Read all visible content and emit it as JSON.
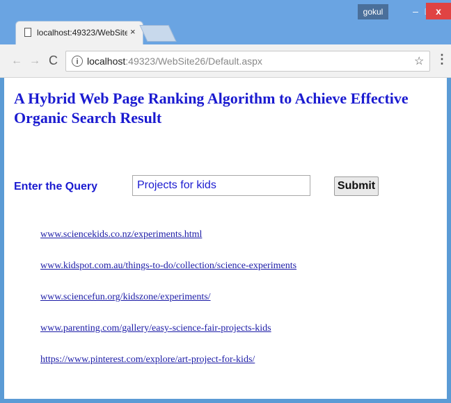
{
  "window": {
    "user_badge": "gokul",
    "minimize_glyph": "–",
    "maximize_glyph": "□",
    "close_glyph": "x"
  },
  "tab": {
    "title": "localhost:49323/WebSite",
    "close_glyph": "×",
    "icon": "page-icon"
  },
  "toolbar": {
    "back_glyph": "←",
    "forward_glyph": "→",
    "reload_glyph": "C",
    "info_glyph": "i",
    "url_host": "localhost",
    "url_rest": ":49323/WebSite26/Default.aspx",
    "star_glyph": "☆",
    "menu_glyph": "⋮"
  },
  "page": {
    "heading": "A Hybrid Web Page Ranking Algorithm to Achieve Effective Organic Search Result",
    "query_label": "Enter the Query",
    "query_value": "Projects for kids",
    "submit_label": "Submit",
    "results": [
      "www.sciencekids.co.nz/experiments.html",
      "www.kidspot.com.au/things-to-do/collection/science-experiments",
      "www.sciencefun.org/kidszone/experiments/",
      "www.parenting.com/gallery/easy-science-fair-projects-kids",
      "https://www.pinterest.com/explore/art-project-for-kids/"
    ]
  },
  "colors": {
    "heading": "#1a1ad0",
    "link": "#1a1aa6",
    "window_frame": "#6aa4e2"
  }
}
